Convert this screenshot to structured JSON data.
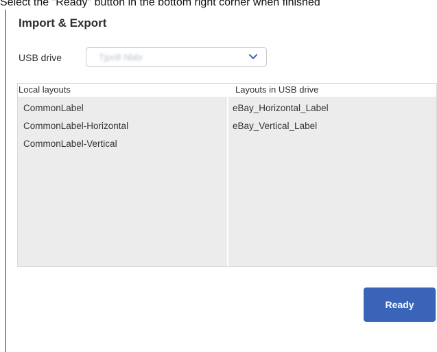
{
  "instruction": "Select the \"Ready\" button in the bottom right corner when finished",
  "dialog": {
    "title": "Import & Export",
    "usb_drive": {
      "label": "USB drive",
      "selected_value": "Tjpn8 Nbbr",
      "icon": "chevron-down-icon",
      "accent_color": "#3a64b7"
    },
    "local_layouts": {
      "header": "Local layouts",
      "items": [
        "CommonLabel",
        "CommonLabel-Horizontal",
        "CommonLabel-Vertical"
      ]
    },
    "usb_layouts": {
      "header": "Layouts in USB drive",
      "items": [
        "eBay_Horizontal_Label",
        "eBay_Vertical_Label"
      ]
    },
    "ready_button": {
      "label": "Ready",
      "color": "#3a64b7"
    }
  }
}
